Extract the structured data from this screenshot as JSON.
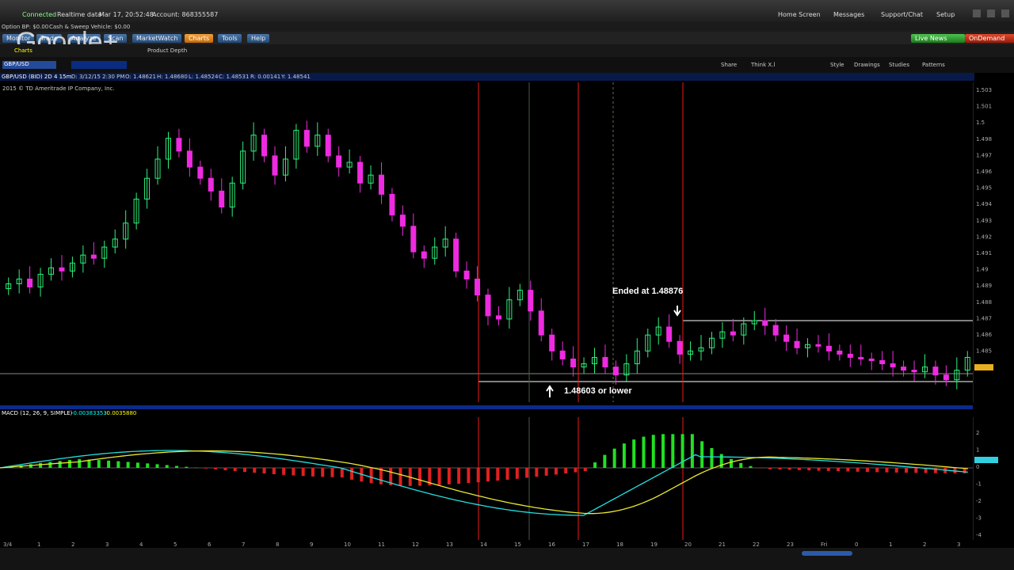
{
  "topbar": {
    "connected": "Connected",
    "realtime": "Realtime data",
    "datetime": "Mar 17, 20:52:48",
    "account": "Account: 868355587",
    "home": "Home Screen",
    "messages": "Messages",
    "support": "Support/Chat",
    "setup": "Setup"
  },
  "subbar": {
    "option_bp": "Option BP: $0.00",
    "cash": "Cash & Sweep Vehicle: $0.00"
  },
  "watermark": "Google+",
  "nav": {
    "tabs": [
      "Monitor",
      "Trade",
      "Analyze",
      "Scan",
      "MarketWatch",
      "Charts",
      "Tools",
      "Help"
    ],
    "active": "Charts",
    "live_news": "Live News",
    "on_demand": "OnDemand"
  },
  "toolrow": {
    "items": [
      "Charts",
      "Product Depth"
    ]
  },
  "chartbar": {
    "symbol": "GBP/USD",
    "tools": [
      "Share",
      "Think X.l",
      "Style",
      "Drawings",
      "Studies",
      "Patterns"
    ]
  },
  "chart_header": {
    "title": "GBP/USD (BID) 2D 4 15m",
    "d": "D: 3/12/15 2:30 PM",
    "o": "O: 1.48621",
    "h": "H: 1.48680",
    "l": "L: 1.48524",
    "c": "C: 1.48531",
    "r": "R: 0.00141",
    "y": "Y: 1.48541"
  },
  "copyright": "2015 © TD Ameritrade IP Company, Inc.",
  "annotations": {
    "ended": "Ended at 1.48876",
    "lower": "1.48603 or lower"
  },
  "macd": {
    "label": "MACD (12, 26, 9, SIMPLE)",
    "value1": "-0.00383353",
    "value2": "-0.0035880"
  },
  "price_axis_labels": [
    "1.503",
    "1.501",
    "1.5",
    "1.498",
    "1.497",
    "1.496",
    "1.495",
    "1.494",
    "1.493",
    "1.492",
    "1.491",
    "1.49",
    "1.489",
    "1.488",
    "1.487",
    "1.486",
    "1.485",
    "1.484"
  ],
  "macd_axis_labels": [
    "2",
    "1",
    "0",
    "-1",
    "-2",
    "-3",
    "-4"
  ],
  "x_axis_labels": [
    "3/4",
    "1",
    "2",
    "3",
    "4",
    "5",
    "6",
    "7",
    "8",
    "9",
    "10",
    "11",
    "12",
    "13",
    "14",
    "15",
    "16",
    "17",
    "18",
    "19",
    "20",
    "21",
    "22",
    "23",
    "Fri",
    "0",
    "1",
    "2",
    "3"
  ],
  "colors": {
    "bull": "#2ef07a",
    "bear": "#ee2be0",
    "hist_pos": "#22e022",
    "hist_neg": "#e02020",
    "macd_line": "#22e0e0",
    "signal_line": "#e8e830",
    "vline": "#ee1a1a"
  },
  "chart_data": {
    "type": "candlestick",
    "symbol": "GBP/USD",
    "closes": [
      1.4912,
      1.4915,
      1.491,
      1.4918,
      1.4922,
      1.492,
      1.4925,
      1.493,
      1.4928,
      1.4935,
      1.494,
      1.495,
      1.4965,
      1.4978,
      1.499,
      1.5003,
      1.4995,
      1.4985,
      1.4978,
      1.497,
      1.496,
      1.4975,
      1.4995,
      1.5005,
      1.4992,
      1.498,
      1.499,
      1.5008,
      1.4998,
      1.5005,
      1.4992,
      1.4985,
      1.4988,
      1.4975,
      1.498,
      1.4968,
      1.4955,
      1.4948,
      1.4932,
      1.4928,
      1.4935,
      1.494,
      1.492,
      1.4915,
      1.4905,
      1.4892,
      1.489,
      1.4902,
      1.4908,
      1.4895,
      1.488,
      1.487,
      1.4865,
      1.486,
      1.4862,
      1.4866,
      1.486,
      1.4855,
      1.4862,
      1.487,
      1.488,
      1.4885,
      1.4876,
      1.4868,
      1.487,
      1.4872,
      1.4878,
      1.4882,
      1.488,
      1.4887,
      1.4889,
      1.4886,
      1.488,
      1.4876,
      1.4872,
      1.4874,
      1.4873,
      1.487,
      1.4868,
      1.4866,
      1.4865,
      1.4864,
      1.4862,
      1.486,
      1.4858,
      1.4857,
      1.486,
      1.4855,
      1.4852,
      1.4858,
      1.4866
    ]
  }
}
